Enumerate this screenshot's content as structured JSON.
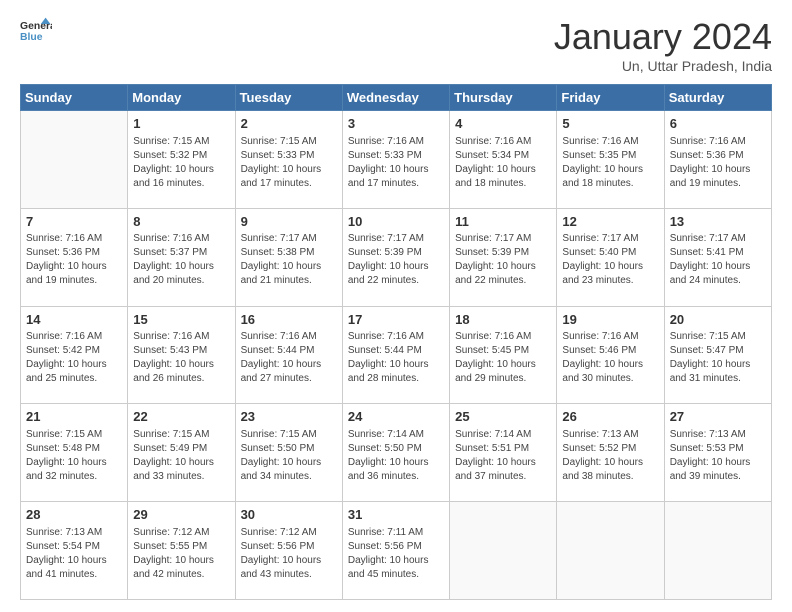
{
  "header": {
    "logo_general": "General",
    "logo_blue": "Blue",
    "title": "January 2024",
    "subtitle": "Un, Uttar Pradesh, India"
  },
  "days_of_week": [
    "Sunday",
    "Monday",
    "Tuesday",
    "Wednesday",
    "Thursday",
    "Friday",
    "Saturday"
  ],
  "weeks": [
    [
      {
        "day": "",
        "info": ""
      },
      {
        "day": "1",
        "info": "Sunrise: 7:15 AM\nSunset: 5:32 PM\nDaylight: 10 hours\nand 16 minutes."
      },
      {
        "day": "2",
        "info": "Sunrise: 7:15 AM\nSunset: 5:33 PM\nDaylight: 10 hours\nand 17 minutes."
      },
      {
        "day": "3",
        "info": "Sunrise: 7:16 AM\nSunset: 5:33 PM\nDaylight: 10 hours\nand 17 minutes."
      },
      {
        "day": "4",
        "info": "Sunrise: 7:16 AM\nSunset: 5:34 PM\nDaylight: 10 hours\nand 18 minutes."
      },
      {
        "day": "5",
        "info": "Sunrise: 7:16 AM\nSunset: 5:35 PM\nDaylight: 10 hours\nand 18 minutes."
      },
      {
        "day": "6",
        "info": "Sunrise: 7:16 AM\nSunset: 5:36 PM\nDaylight: 10 hours\nand 19 minutes."
      }
    ],
    [
      {
        "day": "7",
        "info": "Sunrise: 7:16 AM\nSunset: 5:36 PM\nDaylight: 10 hours\nand 19 minutes."
      },
      {
        "day": "8",
        "info": "Sunrise: 7:16 AM\nSunset: 5:37 PM\nDaylight: 10 hours\nand 20 minutes."
      },
      {
        "day": "9",
        "info": "Sunrise: 7:17 AM\nSunset: 5:38 PM\nDaylight: 10 hours\nand 21 minutes."
      },
      {
        "day": "10",
        "info": "Sunrise: 7:17 AM\nSunset: 5:39 PM\nDaylight: 10 hours\nand 22 minutes."
      },
      {
        "day": "11",
        "info": "Sunrise: 7:17 AM\nSunset: 5:39 PM\nDaylight: 10 hours\nand 22 minutes."
      },
      {
        "day": "12",
        "info": "Sunrise: 7:17 AM\nSunset: 5:40 PM\nDaylight: 10 hours\nand 23 minutes."
      },
      {
        "day": "13",
        "info": "Sunrise: 7:17 AM\nSunset: 5:41 PM\nDaylight: 10 hours\nand 24 minutes."
      }
    ],
    [
      {
        "day": "14",
        "info": "Sunrise: 7:16 AM\nSunset: 5:42 PM\nDaylight: 10 hours\nand 25 minutes."
      },
      {
        "day": "15",
        "info": "Sunrise: 7:16 AM\nSunset: 5:43 PM\nDaylight: 10 hours\nand 26 minutes."
      },
      {
        "day": "16",
        "info": "Sunrise: 7:16 AM\nSunset: 5:44 PM\nDaylight: 10 hours\nand 27 minutes."
      },
      {
        "day": "17",
        "info": "Sunrise: 7:16 AM\nSunset: 5:44 PM\nDaylight: 10 hours\nand 28 minutes."
      },
      {
        "day": "18",
        "info": "Sunrise: 7:16 AM\nSunset: 5:45 PM\nDaylight: 10 hours\nand 29 minutes."
      },
      {
        "day": "19",
        "info": "Sunrise: 7:16 AM\nSunset: 5:46 PM\nDaylight: 10 hours\nand 30 minutes."
      },
      {
        "day": "20",
        "info": "Sunrise: 7:15 AM\nSunset: 5:47 PM\nDaylight: 10 hours\nand 31 minutes."
      }
    ],
    [
      {
        "day": "21",
        "info": "Sunrise: 7:15 AM\nSunset: 5:48 PM\nDaylight: 10 hours\nand 32 minutes."
      },
      {
        "day": "22",
        "info": "Sunrise: 7:15 AM\nSunset: 5:49 PM\nDaylight: 10 hours\nand 33 minutes."
      },
      {
        "day": "23",
        "info": "Sunrise: 7:15 AM\nSunset: 5:50 PM\nDaylight: 10 hours\nand 34 minutes."
      },
      {
        "day": "24",
        "info": "Sunrise: 7:14 AM\nSunset: 5:50 PM\nDaylight: 10 hours\nand 36 minutes."
      },
      {
        "day": "25",
        "info": "Sunrise: 7:14 AM\nSunset: 5:51 PM\nDaylight: 10 hours\nand 37 minutes."
      },
      {
        "day": "26",
        "info": "Sunrise: 7:13 AM\nSunset: 5:52 PM\nDaylight: 10 hours\nand 38 minutes."
      },
      {
        "day": "27",
        "info": "Sunrise: 7:13 AM\nSunset: 5:53 PM\nDaylight: 10 hours\nand 39 minutes."
      }
    ],
    [
      {
        "day": "28",
        "info": "Sunrise: 7:13 AM\nSunset: 5:54 PM\nDaylight: 10 hours\nand 41 minutes."
      },
      {
        "day": "29",
        "info": "Sunrise: 7:12 AM\nSunset: 5:55 PM\nDaylight: 10 hours\nand 42 minutes."
      },
      {
        "day": "30",
        "info": "Sunrise: 7:12 AM\nSunset: 5:56 PM\nDaylight: 10 hours\nand 43 minutes."
      },
      {
        "day": "31",
        "info": "Sunrise: 7:11 AM\nSunset: 5:56 PM\nDaylight: 10 hours\nand 45 minutes."
      },
      {
        "day": "",
        "info": ""
      },
      {
        "day": "",
        "info": ""
      },
      {
        "day": "",
        "info": ""
      }
    ]
  ]
}
